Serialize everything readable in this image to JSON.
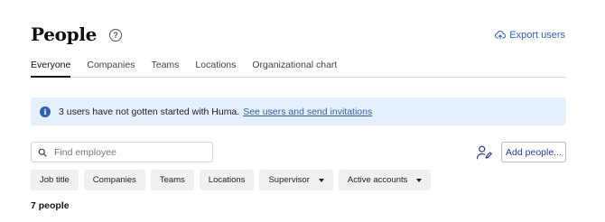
{
  "header": {
    "title": "People",
    "help_icon": "question-circle-icon",
    "export_label": "Export users",
    "export_icon": "cloud-upload-icon"
  },
  "tabs": [
    {
      "label": "Everyone",
      "active": true
    },
    {
      "label": "Companies",
      "active": false
    },
    {
      "label": "Teams",
      "active": false
    },
    {
      "label": "Locations",
      "active": false
    },
    {
      "label": "Organizational chart",
      "active": false
    }
  ],
  "banner": {
    "icon": "info-icon",
    "text": "3 users have not gotten started with Huma.",
    "link": "See users and send invitations",
    "background": "#e6effc"
  },
  "search": {
    "placeholder": "Find employee",
    "value": "",
    "icon": "search-icon"
  },
  "actions": {
    "user_edit_icon": "user-edit-icon",
    "add_people_label": "Add people..."
  },
  "filters": [
    {
      "label": "Job title",
      "dropdown": false
    },
    {
      "label": "Companies",
      "dropdown": false
    },
    {
      "label": "Teams",
      "dropdown": false
    },
    {
      "label": "Locations",
      "dropdown": false
    },
    {
      "label": "Supervisor",
      "dropdown": true
    },
    {
      "label": "Active accounts",
      "dropdown": true
    }
  ],
  "summary": {
    "count_label": "7 people"
  },
  "colors": {
    "link": "#2f5fb3",
    "chip_bg": "#f1f0ee",
    "info_icon": "#2d5fb5"
  }
}
